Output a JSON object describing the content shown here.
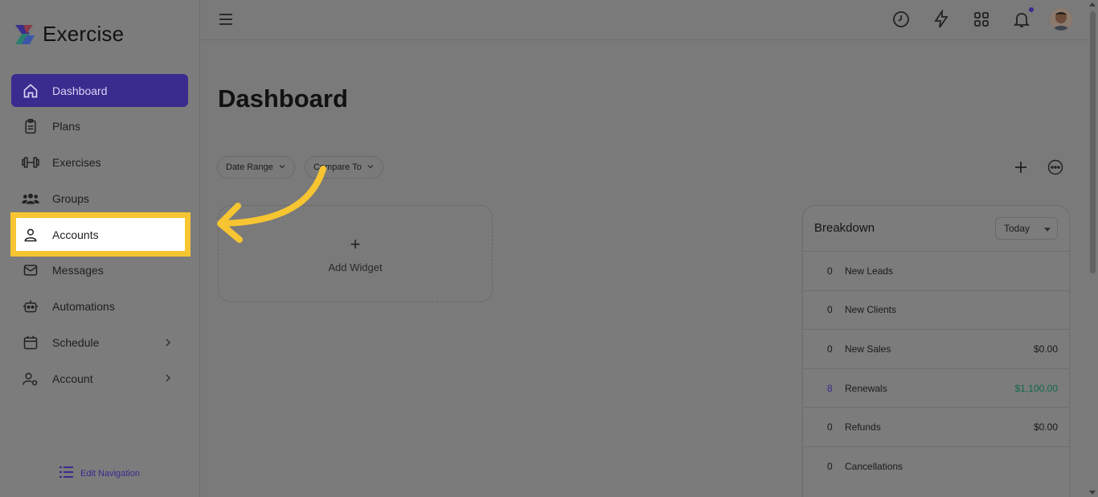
{
  "brand": {
    "name": "Exercise"
  },
  "sidebar": {
    "items": [
      {
        "label": "Dashboard",
        "icon": "home-icon"
      },
      {
        "label": "Plans",
        "icon": "clipboard-icon"
      },
      {
        "label": "Exercises",
        "icon": "dumbbell-icon"
      },
      {
        "label": "Groups",
        "icon": "users-icon"
      },
      {
        "label": "Accounts",
        "icon": "user-icon"
      },
      {
        "label": "Messages",
        "icon": "mail-icon"
      },
      {
        "label": "Automations",
        "icon": "robot-icon"
      },
      {
        "label": "Schedule",
        "icon": "calendar-icon"
      },
      {
        "label": "Account",
        "icon": "user-gear-icon"
      }
    ],
    "edit_navigation": "Edit Navigation"
  },
  "main": {
    "title": "Dashboard",
    "filters": {
      "date_range": "Date Range",
      "compare_to": "Compare To"
    },
    "add_widget": "Add Widget"
  },
  "breakdown": {
    "title": "Breakdown",
    "period": "Today",
    "rows": [
      {
        "count": "0",
        "label": "New Leads",
        "amount": ""
      },
      {
        "count": "0",
        "label": "New Clients",
        "amount": ""
      },
      {
        "count": "0",
        "label": "New Sales",
        "amount": "$0.00"
      },
      {
        "count": "8",
        "label": "Renewals",
        "amount": "$1,100.00"
      },
      {
        "count": "0",
        "label": "Refunds",
        "amount": "$0.00"
      },
      {
        "count": "0",
        "label": "Cancellations",
        "amount": ""
      }
    ]
  },
  "colors": {
    "accent": "#4f3bd1",
    "highlight_outline": "#f6c531",
    "positive": "#11694a"
  }
}
